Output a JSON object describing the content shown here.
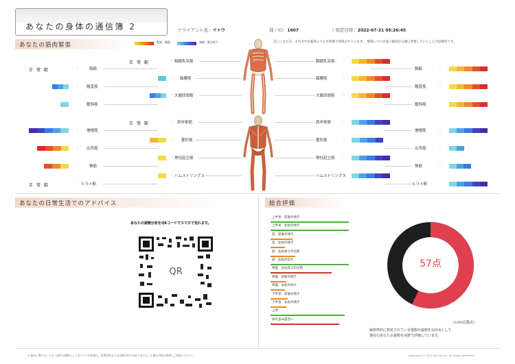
{
  "header": {
    "title": "あなたの身体の通信簿 2",
    "client_label": "クライアント名：",
    "client_value": "イトウ",
    "sama_label": "様",
    "id_label": "/ ID：",
    "id_value": "1607",
    "date_label": "/ 測定日時：",
    "date_value": "2022-07-31 05:26:45"
  },
  "muscle_section": {
    "title": "あなたの筋肉緊張",
    "legend_tight": "緊張・硬直",
    "legend_weak": "弛緩・筋力低下",
    "note": "正しい立ち方、それぞれの筋肉レベルの状態で評価されています。　緊張レベルの高い筋肉から順に改善していくことが効果的です。"
  },
  "normal_text": "正常範",
  "left_front": [
    {
      "label": "胸筋",
      "normal": true
    },
    {
      "label": "腹直筋",
      "normal": false
    },
    {
      "label": "腹斜筋",
      "normal": false
    }
  ],
  "center_front": [
    {
      "label": "胸鎖乳突筋",
      "normal": true
    },
    {
      "label": "腸腰筋",
      "normal": false
    },
    {
      "label": "大腿四頭筋",
      "normal": false
    }
  ],
  "right_front": [
    {
      "label": "胸鎖乳突筋"
    },
    {
      "label": "腸腰筋"
    },
    {
      "label": "大腿四頭筋"
    }
  ],
  "far_right_front": [
    {
      "label": "胸筋"
    },
    {
      "label": "腹直筋"
    },
    {
      "label": "腹斜筋"
    }
  ],
  "left_back": [
    {
      "label": "僧帽筋",
      "normal": false
    },
    {
      "label": "広背筋",
      "normal": false
    },
    {
      "label": "臀筋",
      "normal": false
    },
    {
      "label": "ヒラメ筋",
      "normal": true
    }
  ],
  "center_back": [
    {
      "label": "肩甲挙筋",
      "normal": true
    },
    {
      "label": "菱形筋",
      "normal": false
    },
    {
      "label": "脊柱起立筋",
      "normal": false
    },
    {
      "label": "ハムストリングス",
      "normal": false
    }
  ],
  "right_back": [
    {
      "label": "肩甲挙筋"
    },
    {
      "label": "菱形筋"
    },
    {
      "label": "脊柱起立筋"
    },
    {
      "label": "ハムストリングス"
    }
  ],
  "far_right_back": [
    {
      "label": "僧帽筋"
    },
    {
      "label": "広背筋"
    },
    {
      "label": "臀筋"
    },
    {
      "label": "ヒラメ筋"
    }
  ],
  "advice": {
    "title": "あなたの日常生活でのアドバイス",
    "caption": "あなたの姿勢分析をQRコードでスマホで見れます。",
    "qr_label": "QR"
  },
  "evaluation": {
    "title": "総合評価",
    "rows": [
      {
        "label": "上半身　前後の傾き",
        "fill": 1.0,
        "color": "#4caf3a"
      },
      {
        "label": "上半身　左右の傾き",
        "fill": 1.0,
        "color": "#4caf3a"
      },
      {
        "label": "首　前後の傾き",
        "fill": 0.28,
        "color": "#e8891d"
      },
      {
        "label": "首　左右の傾き",
        "fill": 0.18,
        "color": "#e8891d"
      },
      {
        "label": "肩　左右高さの比較",
        "fill": 0.32,
        "color": "#e8891d"
      },
      {
        "label": "肩　左右の捻れ",
        "fill": 1.0,
        "color": "#4caf3a"
      },
      {
        "label": "骨盤　左右高さの比較",
        "fill": 0.78,
        "color": "#c0392b"
      },
      {
        "label": "骨盤　前後の傾き",
        "fill": 0.2,
        "color": "#e8891d"
      },
      {
        "label": "骨盤　左右の捻れ",
        "fill": 0.18,
        "color": "#e8891d"
      },
      {
        "label": "下半身　前後の傾き",
        "fill": 0.22,
        "color": "#e8891d"
      },
      {
        "label": "下半身　左右の傾き",
        "fill": 0.2,
        "color": "#e8891d"
      },
      {
        "label": "上体",
        "fill": 0.95,
        "color": "#4caf3a"
      },
      {
        "label": "体の歪み度合い",
        "fill": 0.88,
        "color": "#c0392b"
      }
    ],
    "score": 57,
    "score_text": "57点",
    "score_note": "(100点満点)",
    "desc_line1": "解剖学的に想定されている理想の姿勢を100点として、",
    "desc_line2": "現在のあなたの姿勢を点数で評価しています。",
    "colors": {
      "score": "#e0404e",
      "rest": "#1e1e1e"
    }
  },
  "footer": {
    "left": "※ 痛みに関することは一般的な情報として本アプリの結果は、医療診断または治療目的ではありません。正確な判断は医師にご相談ください。",
    "right": "Copyright (C) 2022 Kb Lab Inc. All Rights Reserved."
  }
}
